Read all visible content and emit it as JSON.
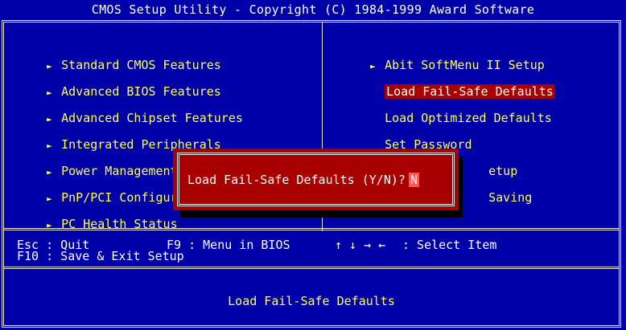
{
  "title": "CMOS Setup Utility - Copyright (C) 1984-1999 Award Software",
  "left_menu": [
    {
      "label": "Standard CMOS Features",
      "submenu": true
    },
    {
      "label": "Advanced BIOS Features",
      "submenu": true
    },
    {
      "label": "Advanced Chipset Features",
      "submenu": true
    },
    {
      "label": "Integrated Peripherals",
      "submenu": true
    },
    {
      "label": "Power Management",
      "submenu": true
    },
    {
      "label": "PnP/PCI Configura",
      "submenu": true
    },
    {
      "label": "PC Health Status",
      "submenu": true
    }
  ],
  "right_menu": [
    {
      "label": "Abit SoftMenu II Setup",
      "submenu": true
    },
    {
      "label": "Load Fail-Safe Defaults",
      "submenu": false,
      "selected": true
    },
    {
      "label": "Load Optimized Defaults",
      "submenu": false
    },
    {
      "label": "Set Password",
      "submenu": false
    },
    {
      "label": "etup",
      "submenu": false
    },
    {
      "label": "Saving",
      "submenu": false
    }
  ],
  "arrow_glyph": "►",
  "hints": {
    "esc": "Esc : Quit",
    "f9": "F9 : Menu in BIOS",
    "arrows": "↑ ↓ → ←",
    "select": ": Select Item",
    "f10": "F10 : Save & Exit Setup"
  },
  "status_text": "Load Fail-Safe Defaults",
  "dialog": {
    "prompt": "Load Fail-Safe Defaults (Y/N)?",
    "answer": "N"
  },
  "colors": {
    "background": "#0000a8",
    "text": "#ffff55",
    "highlight": "#a80000",
    "border": "#e8e8e8"
  }
}
